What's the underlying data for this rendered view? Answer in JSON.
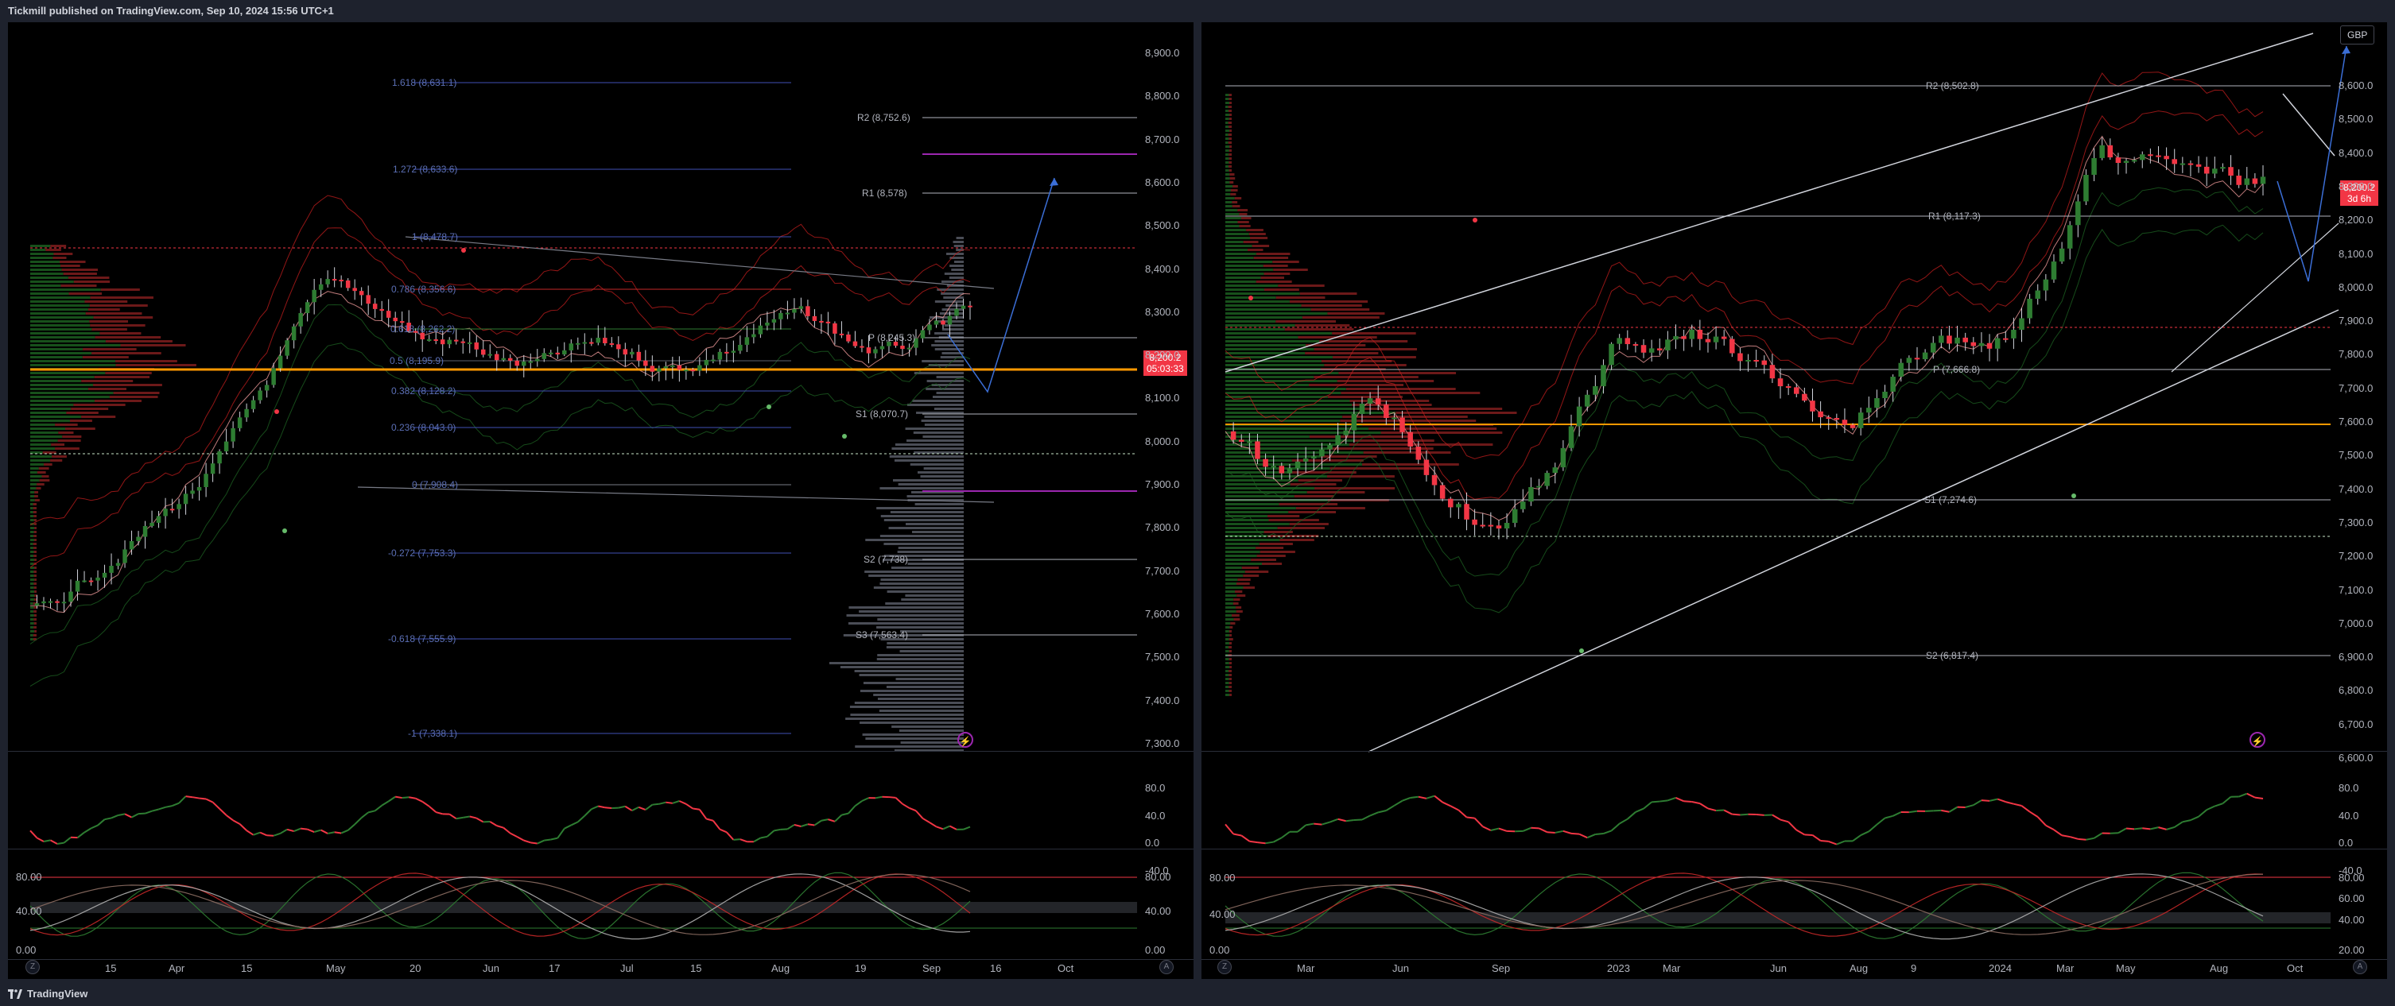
{
  "header": {
    "published_text": "Tickmill published on TradingView.com, Sep 10, 2024 15:56 UTC+1"
  },
  "footer": {
    "brand": "TradingView"
  },
  "colors": {
    "up": "#2e7d32",
    "down": "#f23645",
    "fib": "#3f51b5",
    "pivot": "#b2b5be",
    "accent_orange": "#ff9800",
    "purple": "#9c27b0",
    "bg": "#000000"
  },
  "left_chart": {
    "price_axis": [
      "8,900.0",
      "8,800.0",
      "8,700.0",
      "8,600.0",
      "8,500.0",
      "8,400.0",
      "8,300.0",
      "8,200.0",
      "8,100.0",
      "8,000.0",
      "7,900.0",
      "7,800.0",
      "7,700.0",
      "7,600.0",
      "7,500.0",
      "7,400.0",
      "7,300.0"
    ],
    "time_axis": [
      "15",
      "Apr",
      "15",
      "May",
      "20",
      "Jun",
      "17",
      "Jul",
      "15",
      "Aug",
      "19",
      "Sep",
      "16",
      "Oct"
    ],
    "current_price": "8,200.2",
    "countdown": "05:03:33",
    "fib_levels": [
      "1.618 (8,631.1)",
      "1.272 (8,633.6)",
      "1 (8,478.7)",
      "0.786 (8,356.6)",
      "0.618 (8,262.2)",
      "0.5 (8,195.9)",
      "0.382 (8,128.2)",
      "0.236 (8,043.0)",
      "0 (7,908.4)",
      "-0.272 (7,753.3)",
      "-0.618 (7,555.9)",
      "-1 (7,338.1)"
    ],
    "pivots": [
      "R2 (8,752.6)",
      "R1 (8,578)",
      "P (8,245.3)",
      "S1 (8,070.7)",
      "S2 (7,738)",
      "S3 (7,563.4)"
    ],
    "osc1_axis": [
      "80.0",
      "40.0",
      "0.0",
      "-40.0"
    ],
    "osc2_axis": [
      "80.00",
      "40.00",
      "0.00"
    ],
    "osc2_left_axis": [
      "80.00",
      "40.00",
      "0.00"
    ],
    "corner_left": "Z",
    "corner_right": "A",
    "bolt": "⚡"
  },
  "right_chart": {
    "currency": "GBP",
    "price_axis": [
      "8,600.0",
      "8,500.0",
      "8,400.0",
      "8,300.0",
      "8,200.0",
      "8,100.0",
      "8,000.0",
      "7,900.0",
      "7,800.0",
      "7,700.0",
      "7,600.0",
      "7,500.0",
      "7,400.0",
      "7,300.0",
      "7,200.0",
      "7,100.0",
      "7,000.0",
      "6,900.0",
      "6,800.0",
      "6,700.0",
      "6,600.0"
    ],
    "time_axis": [
      "Mar",
      "Jun",
      "Sep",
      "2023",
      "Mar",
      "Jun",
      "Aug",
      "9",
      "2024",
      "Mar",
      "May",
      "Aug",
      "Oct"
    ],
    "current_price": "8,200.2",
    "countdown": "3d 6h",
    "pivots": [
      "R2 (8,502.8)",
      "R1 (8,117.3)",
      "P (7,666.8)",
      "S1 (7,274.6)",
      "S2 (6,817.4)"
    ],
    "osc1_axis": [
      "80.0",
      "40.0",
      "0.0",
      "-40.0"
    ],
    "osc2_axis": [
      "80.00",
      "60.00",
      "40.00",
      "20.00"
    ],
    "osc2_left_axis": [
      "80.00",
      "40.00",
      "0.00"
    ],
    "corner_left": "Z",
    "corner_right": "A",
    "bolt": "⚡"
  }
}
